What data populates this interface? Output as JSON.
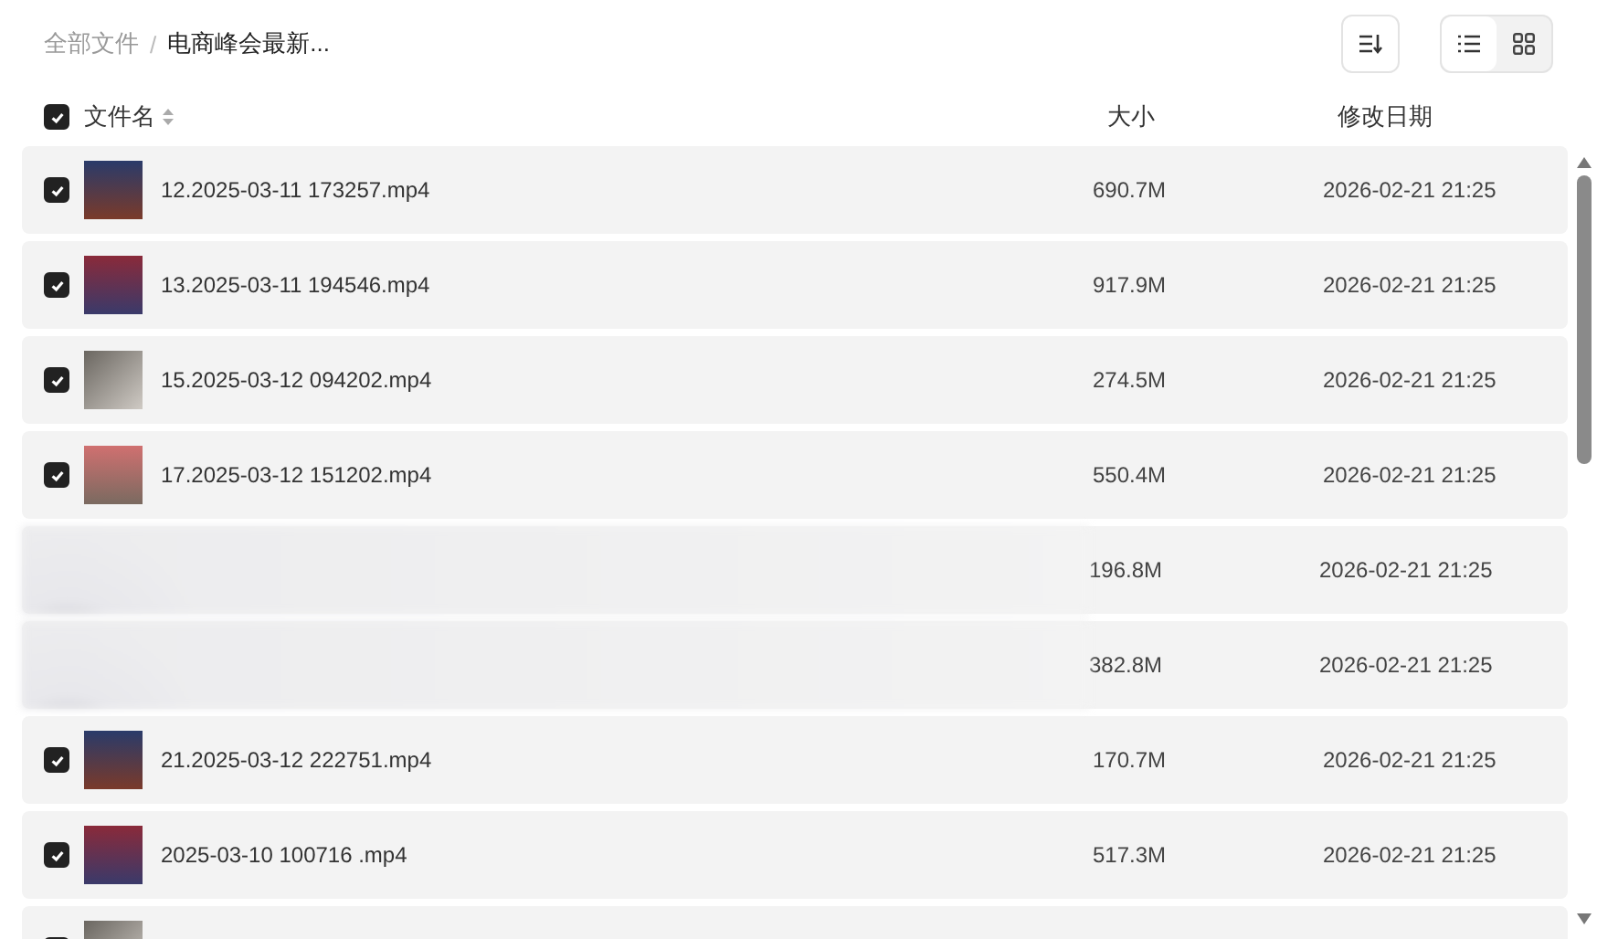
{
  "breadcrumb": [
    "全部文件",
    "电商峰会最新..."
  ],
  "breadcrumb_separator": "/",
  "view_modes": [
    {
      "kind": "list",
      "selected": true
    },
    {
      "kind": "grid",
      "selected": false
    }
  ],
  "header": {
    "checked": true,
    "name": "文件名",
    "size": "大小",
    "modified": "修改日期"
  },
  "rows": [
    {
      "kind": "file",
      "checked": true,
      "name": "12.2025-03-11 173257.mp4",
      "size": "690.7M",
      "modified": "2026-02-21 21:25"
    },
    {
      "kind": "file",
      "checked": true,
      "name": "13.2025-03-11 194546.mp4",
      "size": "917.9M",
      "modified": "2026-02-21 21:25"
    },
    {
      "kind": "file",
      "checked": true,
      "name": "15.2025-03-12 094202.mp4",
      "size": "274.5M",
      "modified": "2026-02-21 21:25"
    },
    {
      "kind": "file",
      "checked": true,
      "name": "17.2025-03-12 151202.mp4",
      "size": "550.4M",
      "modified": "2026-02-21 21:25"
    },
    {
      "kind": "obscured",
      "size": "196.8M",
      "modified": "2026-02-21 21:25"
    },
    {
      "kind": "obscured",
      "size": "382.8M",
      "modified": "2026-02-21 21:25"
    },
    {
      "kind": "file",
      "checked": true,
      "name": "21.2025-03-12 222751.mp4",
      "size": "170.7M",
      "modified": "2026-02-21 21:25"
    },
    {
      "kind": "file",
      "checked": true,
      "name": "2025-03-10 100716 .mp4",
      "size": "517.3M",
      "modified": "2026-02-21 21:25"
    },
    {
      "kind": "file",
      "checked": true
    }
  ]
}
